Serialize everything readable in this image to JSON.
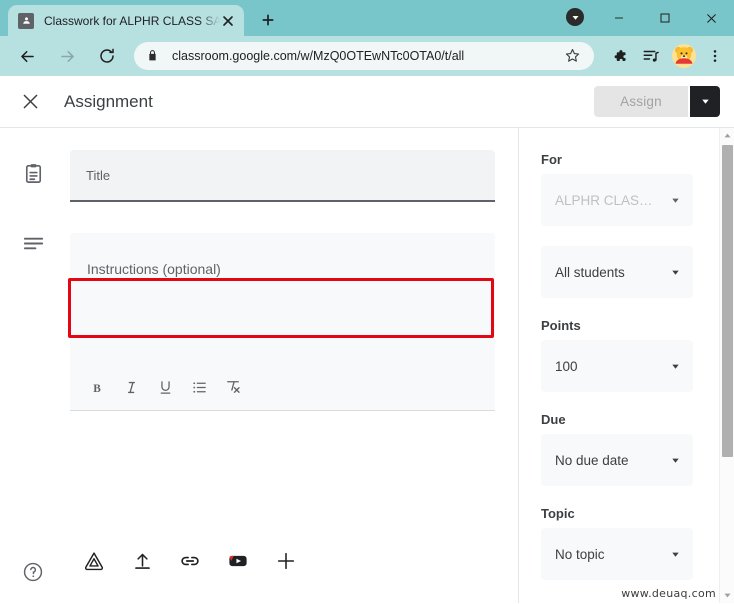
{
  "window": {
    "minimize_label": "Minimize",
    "maximize_label": "Maximize",
    "close_label": "Close",
    "download_indicator": "download-indicator"
  },
  "browser": {
    "theme_color": "#78c6c9",
    "tab": {
      "title": "Classwork for ALPHR CLASS SAM",
      "favicon": "classroom-favicon",
      "close_label": "Close tab"
    },
    "new_tab_label": "New Tab",
    "nav": {
      "back_label": "Back",
      "forward_label": "Forward",
      "reload_label": "Reload"
    },
    "omnibox": {
      "url": "classroom.google.com/w/MzQ0OTEwNTc0OTA0/t/all",
      "lock_icon": "lock-icon",
      "bookmark_icon": "star-icon"
    },
    "toolbar_icons": {
      "extensions": "puzzle-piece-icon",
      "reading_list": "reading-list-icon",
      "profile": "avatar-winnie-the-pooh",
      "menu": "three-dot-menu-icon"
    }
  },
  "app": {
    "close_label": "Close",
    "title": "Assignment",
    "assign_button": "Assign",
    "assign_button_disabled": true,
    "assign_caret_label": "Assign options",
    "help_label": "Help"
  },
  "form": {
    "title_field": {
      "icon": "assignment-clipboard-icon",
      "placeholder": "Title",
      "value": "",
      "highlighted": true,
      "highlight_color": "#e30613"
    },
    "instructions_field": {
      "icon": "description-lines-icon",
      "placeholder": "Instructions (optional)",
      "value": ""
    },
    "format_toolbar": [
      {
        "name": "bold-icon",
        "label": "B"
      },
      {
        "name": "italic-icon",
        "label": "I"
      },
      {
        "name": "underline-icon",
        "label": "U"
      },
      {
        "name": "bulleted-list-icon",
        "label": "Bulleted list"
      },
      {
        "name": "clear-formatting-icon",
        "label": "Clear formatting"
      }
    ],
    "attachments": [
      {
        "name": "google-drive-icon",
        "label": "Google Drive"
      },
      {
        "name": "upload-icon",
        "label": "Upload"
      },
      {
        "name": "link-icon",
        "label": "Link"
      },
      {
        "name": "youtube-icon",
        "label": "YouTube"
      },
      {
        "name": "create-plus-icon",
        "label": "Create"
      }
    ]
  },
  "sidebar": {
    "for_label": "For",
    "class_value": "ALPHR CLAS…",
    "class_disabled": true,
    "students_value": "All students",
    "points_label": "Points",
    "points_value": "100",
    "due_label": "Due",
    "due_value": "No due date",
    "topic_label": "Topic",
    "topic_value": "No topic"
  },
  "watermark": "www.deuaq.com"
}
